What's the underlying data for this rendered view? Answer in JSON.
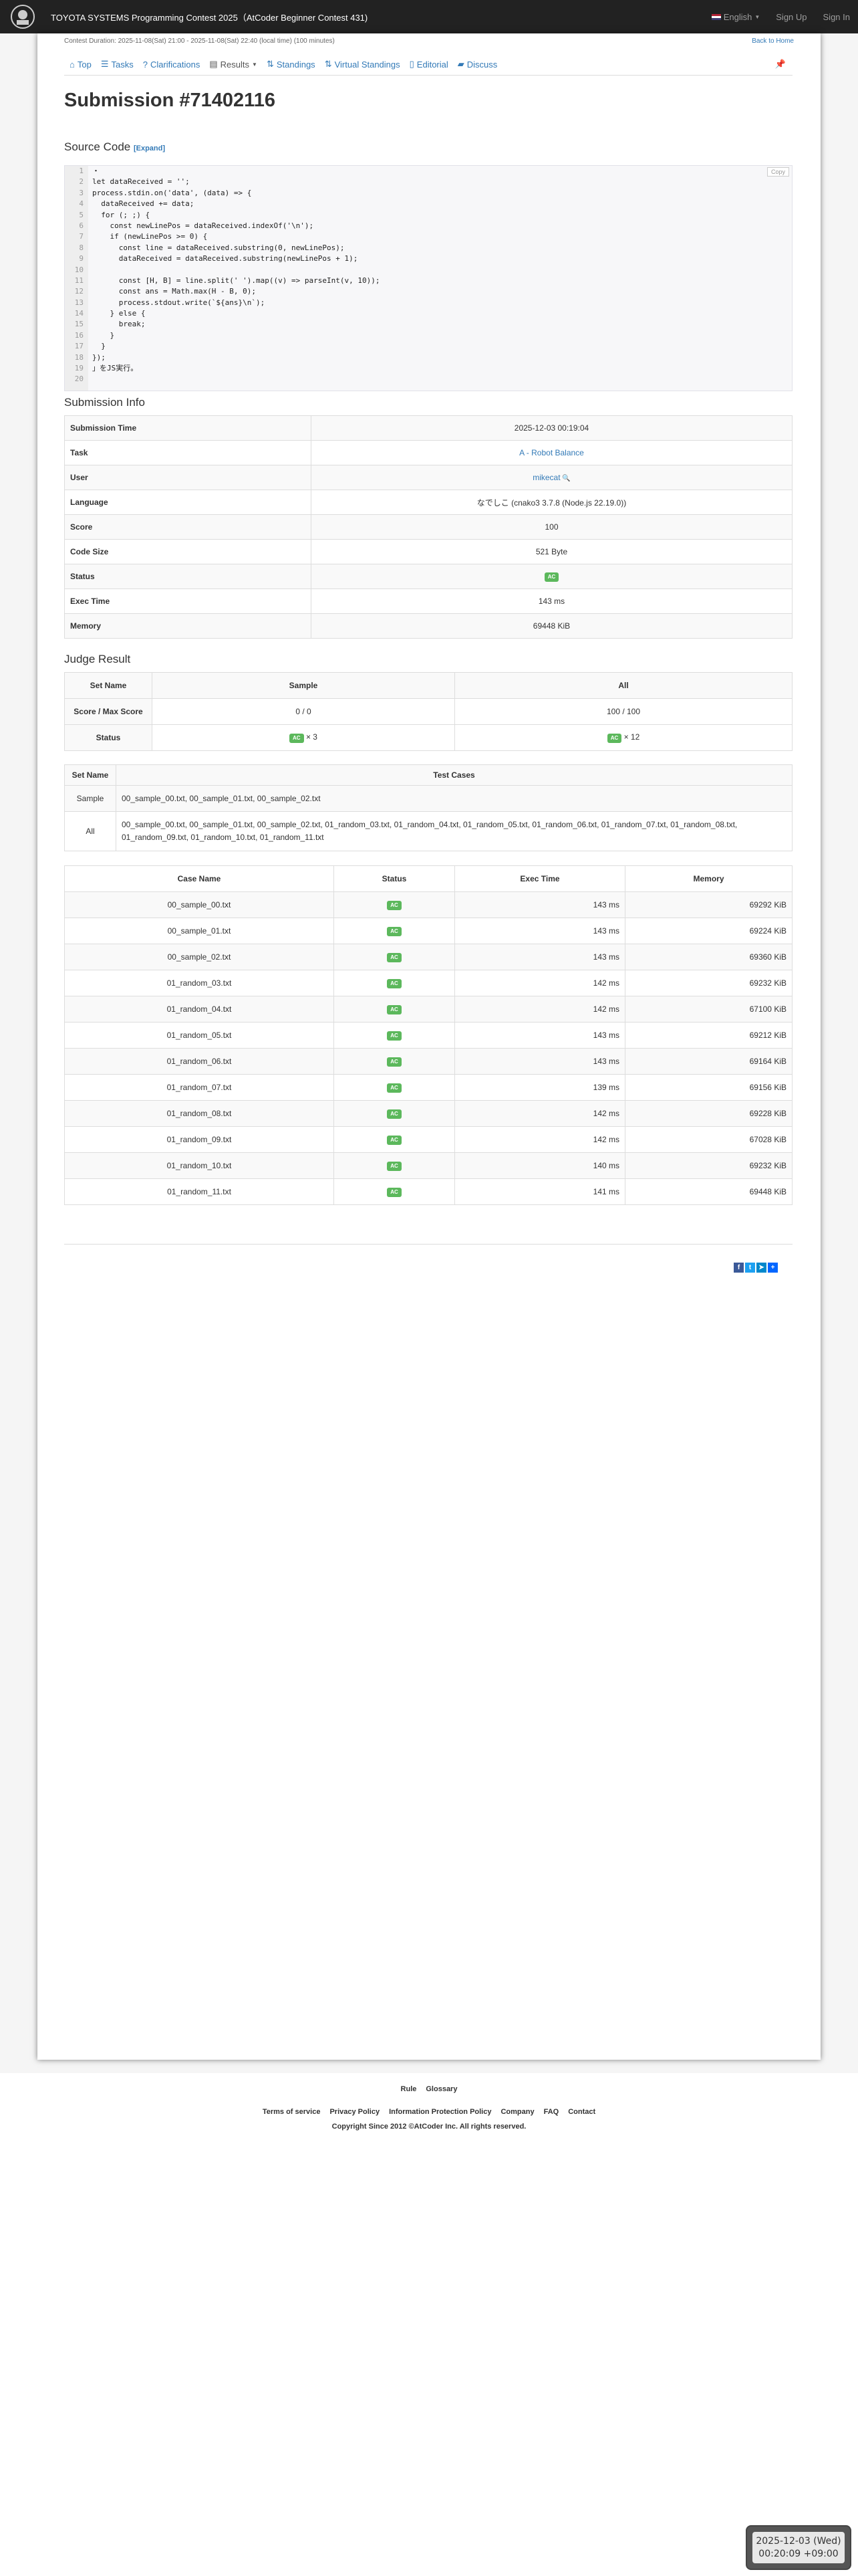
{
  "topbar": {
    "contest_title": "TOYOTA SYSTEMS Programming Contest 2025（AtCoder Beginner Contest 431)",
    "language": "English",
    "signup": "Sign Up",
    "signin": "Sign In"
  },
  "header": {
    "duration": "Contest Duration: 2025-11-08(Sat) 21:00 - 2025-11-08(Sat) 22:40 (local time) (100 minutes)",
    "back_home": "Back to Home"
  },
  "nav": {
    "items": [
      {
        "label": "Top",
        "icon": "home-icon"
      },
      {
        "label": "Tasks",
        "icon": "list-icon"
      },
      {
        "label": "Clarifications",
        "icon": "question-circle-icon"
      },
      {
        "label": "Results",
        "icon": "results-icon"
      },
      {
        "label": "Standings",
        "icon": "sort-icon"
      },
      {
        "label": "Virtual Standings",
        "icon": "sort-icon"
      },
      {
        "label": "Editorial",
        "icon": "book-icon"
      },
      {
        "label": "Discuss",
        "icon": "comment-icon"
      }
    ]
  },
  "page_title": "Submission #71402116",
  "source": {
    "heading": "Source Code",
    "expand": "[Expand]",
    "copy": "Copy",
    "lines": [
      "・",
      "let dataReceived = '';",
      "process.stdin.on('data', (data) => {",
      "  dataReceived += data;",
      "  for (; ;) {",
      "    const newLinePos = dataReceived.indexOf('\\n');",
      "    if (newLinePos >= 0) {",
      "      const line = dataReceived.substring(0, newLinePos);",
      "      dataReceived = dataReceived.substring(newLinePos + 1);",
      "",
      "      const [H, B] = line.split(' ').map((v) => parseInt(v, 10));",
      "      const ans = Math.max(H - B, 0);",
      "      process.stdout.write(`${ans}\\n`);",
      "    } else {",
      "      break;",
      "    }",
      "  }",
      "});",
      "」をJS実行。",
      ""
    ]
  },
  "info": {
    "heading": "Submission Info",
    "rows": [
      {
        "label": "Submission Time",
        "value": "2025-12-03 00:19:04"
      },
      {
        "label": "Task",
        "value": "A - Robot Balance"
      },
      {
        "label": "User",
        "value": "mikecat"
      },
      {
        "label": "Language",
        "value": "なでしこ (cnako3 3.7.8 (Node.js 22.19.0))"
      },
      {
        "label": "Score",
        "value": "100"
      },
      {
        "label": "Code Size",
        "value": "521 Byte"
      },
      {
        "label": "Status",
        "value": "AC"
      },
      {
        "label": "Exec Time",
        "value": "143 ms"
      },
      {
        "label": "Memory",
        "value": "69448 KiB"
      }
    ]
  },
  "judge": {
    "heading": "Judge Result",
    "headers": [
      "Set Name",
      "Sample",
      "All"
    ],
    "score_label": "Score / Max Score",
    "sample_score": "0 / 0",
    "all_score": "100 / 100",
    "status_label": "Status",
    "sample_count": "× 3",
    "all_count": "× 12",
    "ac": "AC"
  },
  "testsets": {
    "headers": [
      "Set Name",
      "Test Cases"
    ],
    "rows": [
      {
        "name": "Sample",
        "cases": "00_sample_00.txt, 00_sample_01.txt, 00_sample_02.txt"
      },
      {
        "name": "All",
        "cases": "00_sample_00.txt, 00_sample_01.txt, 00_sample_02.txt, 01_random_03.txt, 01_random_04.txt, 01_random_05.txt, 01_random_06.txt, 01_random_07.txt, 01_random_08.txt, 01_random_09.txt, 01_random_10.txt, 01_random_11.txt"
      }
    ]
  },
  "cases": {
    "headers": [
      "Case Name",
      "Status",
      "Exec Time",
      "Memory"
    ],
    "rows": [
      {
        "name": "00_sample_00.txt",
        "status": "AC",
        "time": "143 ms",
        "memory": "69292 KiB"
      },
      {
        "name": "00_sample_01.txt",
        "status": "AC",
        "time": "143 ms",
        "memory": "69224 KiB"
      },
      {
        "name": "00_sample_02.txt",
        "status": "AC",
        "time": "143 ms",
        "memory": "69360 KiB"
      },
      {
        "name": "01_random_03.txt",
        "status": "AC",
        "time": "142 ms",
        "memory": "69232 KiB"
      },
      {
        "name": "01_random_04.txt",
        "status": "AC",
        "time": "142 ms",
        "memory": "67100 KiB"
      },
      {
        "name": "01_random_05.txt",
        "status": "AC",
        "time": "143 ms",
        "memory": "69212 KiB"
      },
      {
        "name": "01_random_06.txt",
        "status": "AC",
        "time": "143 ms",
        "memory": "69164 KiB"
      },
      {
        "name": "01_random_07.txt",
        "status": "AC",
        "time": "139 ms",
        "memory": "69156 KiB"
      },
      {
        "name": "01_random_08.txt",
        "status": "AC",
        "time": "142 ms",
        "memory": "69228 KiB"
      },
      {
        "name": "01_random_09.txt",
        "status": "AC",
        "time": "142 ms",
        "memory": "67028 KiB"
      },
      {
        "name": "01_random_10.txt",
        "status": "AC",
        "time": "140 ms",
        "memory": "69232 KiB"
      },
      {
        "name": "01_random_11.txt",
        "status": "AC",
        "time": "141 ms",
        "memory": "69448 KiB"
      }
    ]
  },
  "footer": {
    "row1": [
      "Rule",
      "Glossary"
    ],
    "row2": [
      "Terms of service",
      "Privacy Policy",
      "Information Protection Policy",
      "Company",
      "FAQ",
      "Contact"
    ],
    "copyright": "Copyright Since 2012 ©AtCoder Inc. All rights reserved."
  },
  "clock": {
    "date": "2025-12-03 (Wed)",
    "time": "00:20:09 +09:00"
  },
  "colors": {
    "accent": "#337ab7",
    "ac": "#5cb85c",
    "topbar": "#222222"
  }
}
